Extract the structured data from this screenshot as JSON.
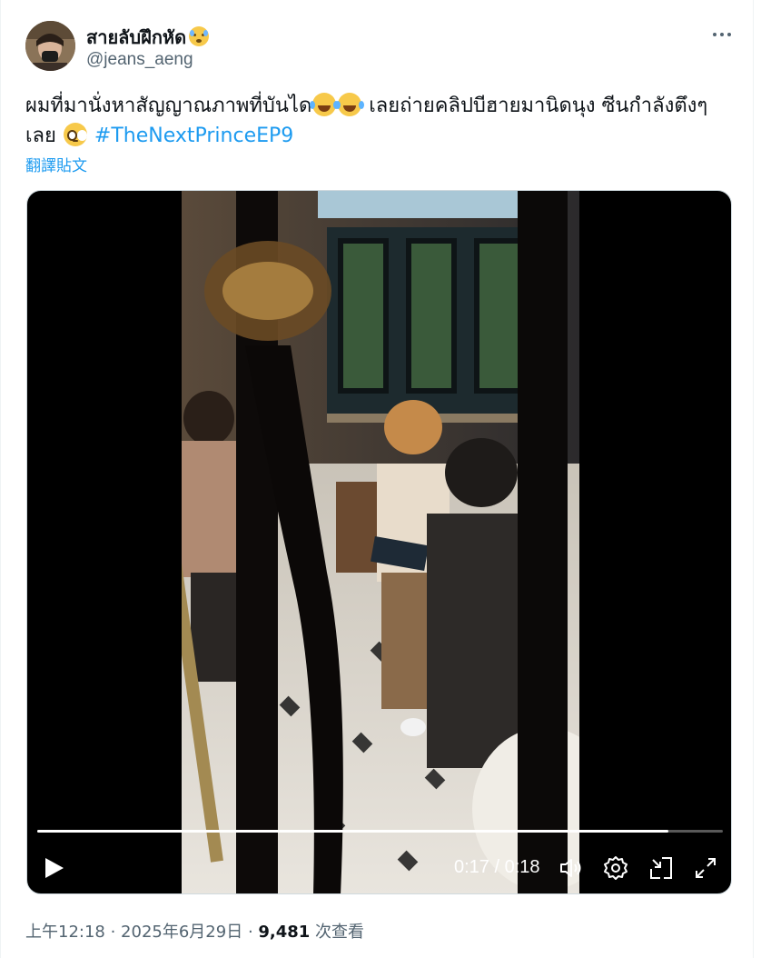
{
  "author": {
    "display_name": "สายลับฝึกหัด",
    "handle": "@jeans_aeng",
    "name_emoji": "face-with-tears-icon"
  },
  "header": {
    "more_icon": "more-horizontal-icon"
  },
  "tweet": {
    "text_part1": "ผมที่มานั่งหาสัญญาณภาพที่บันได",
    "emoji_1": "face-with-tears-of-joy-icon",
    "emoji_2": "face-with-tears-of-joy-icon",
    "text_part2": " เลยถ่ายคลิปบีฮายมานิดนุง ซีนกำลังตึงๆ เลย ",
    "emoji_3": "pleading-face-icon",
    "hashtag": "#TheNextPrinceEP9",
    "translate_label": "翻譯貼文"
  },
  "video": {
    "time_display": "0:17 / 0:18",
    "progress": 0.92,
    "controls": [
      "play-icon",
      "volume-icon",
      "settings-icon",
      "picture-in-picture-icon",
      "fullscreen-icon"
    ]
  },
  "meta": {
    "time": "上午12:18",
    "separator": " · ",
    "date": "2025年6月29日",
    "views_count": "9,481",
    "views_label": " 次查看"
  },
  "colors": {
    "link": "#1d9bf0",
    "secondary_text": "#536471",
    "primary_text": "#0f1419"
  }
}
